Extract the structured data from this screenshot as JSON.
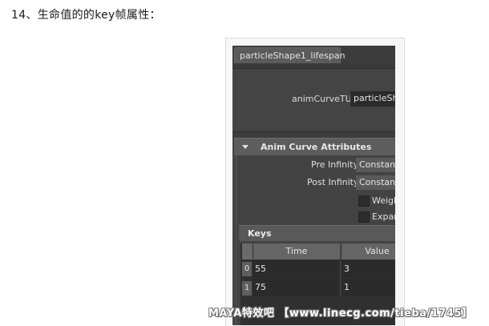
{
  "heading": "14、生命值的的key帧属性：",
  "maya": {
    "tab_label": "particleShape1_lifespan",
    "node_label": "animCurveTU:",
    "node_value": "particleSha",
    "section_title": "Anim Curve Attributes",
    "pre_infinity_label": "Pre Infinity",
    "pre_infinity_value": "Constant",
    "post_infinity_label": "Post Infinity",
    "post_infinity_value": "Constant",
    "weighted_label": "Weigh",
    "expand_label": "Expan",
    "keys_title": "Keys",
    "columns": [
      "Time",
      "Value"
    ],
    "rows": [
      {
        "index": "0",
        "time": "55",
        "value": "3"
      },
      {
        "index": "1",
        "time": "75",
        "value": "1"
      }
    ]
  },
  "watermark": "MAYA特效吧 【www.linecg.com/tieba/1745】"
}
